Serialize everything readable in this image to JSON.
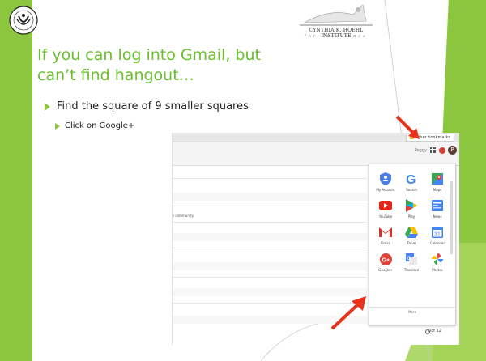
{
  "slide": {
    "title": "If you can log into Gmail, but can’t find hangout…",
    "bullet": "Find the square of 9 smaller squares",
    "sub_bullet": "Click on Google+",
    "logo": {
      "institute": "CYNTHIA K. HOEHL INSTITUTE",
      "tagline": "for Excellence"
    }
  },
  "screenshot": {
    "bookmarks_label": "Other bookmarks",
    "user_name": "Peggy",
    "avatar_letter": "P",
    "community_text": "s community",
    "more_label": "More",
    "clock_text": "Oct 12",
    "apps": [
      {
        "label": "My Account",
        "icon": "my-account-icon"
      },
      {
        "label": "Search",
        "icon": "google-search-icon"
      },
      {
        "label": "Maps",
        "icon": "maps-icon"
      },
      {
        "label": "YouTube",
        "icon": "youtube-icon"
      },
      {
        "label": "Play",
        "icon": "play-store-icon"
      },
      {
        "label": "News",
        "icon": "news-icon"
      },
      {
        "label": "Gmail",
        "icon": "gmail-icon"
      },
      {
        "label": "Drive",
        "icon": "drive-icon"
      },
      {
        "label": "Calendar",
        "icon": "calendar-icon"
      },
      {
        "label": "Google+",
        "icon": "google-plus-icon"
      },
      {
        "label": "Translate",
        "icon": "translate-icon"
      },
      {
        "label": "Photos",
        "icon": "photos-icon"
      }
    ]
  },
  "colors": {
    "accent_green": "#8cc63f",
    "title_green": "#6abf2d",
    "annotation_red": "#e8321c"
  }
}
